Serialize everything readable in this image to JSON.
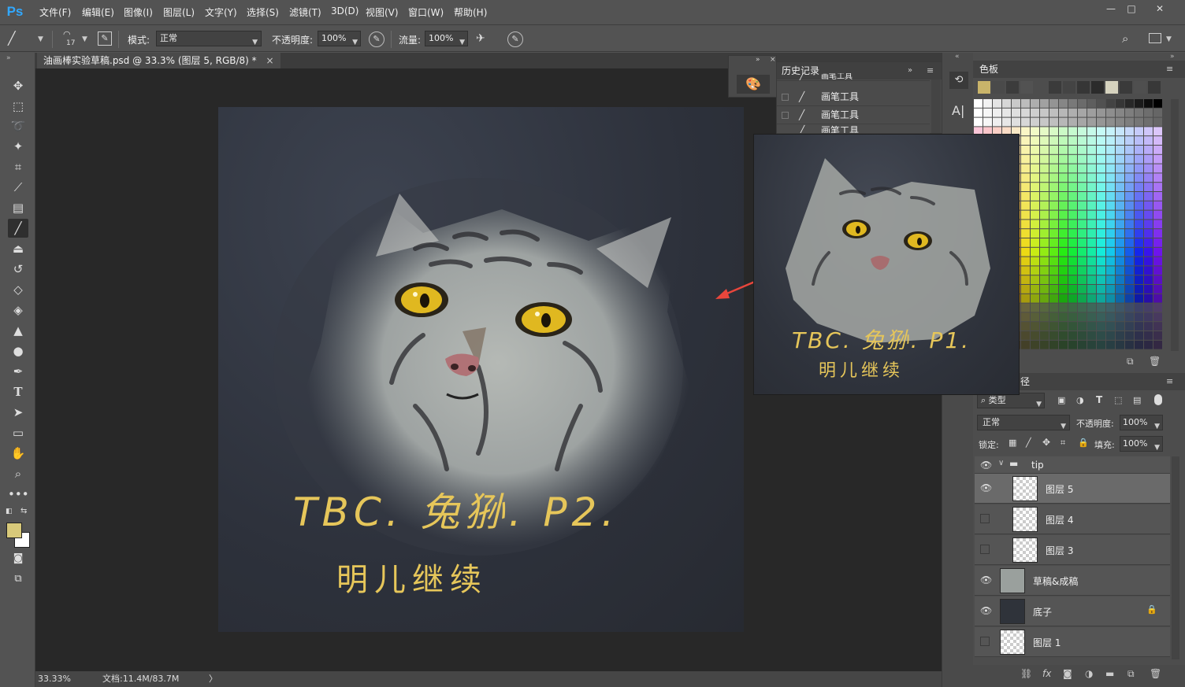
{
  "app": {
    "logo": "Ps"
  },
  "menu": [
    "文件(F)",
    "编辑(E)",
    "图像(I)",
    "图层(L)",
    "文字(Y)",
    "选择(S)",
    "滤镜(T)",
    "3D(D)",
    "视图(V)",
    "窗口(W)",
    "帮助(H)"
  ],
  "window_buttons": {
    "minimize": "—",
    "maximize": "□",
    "close": "✕"
  },
  "options": {
    "brush_size": "17",
    "mode_label": "模式:",
    "mode_value": "正常",
    "opacity_label": "不透明度:",
    "opacity_value": "100%",
    "flow_label": "流量:",
    "flow_value": "100%"
  },
  "document": {
    "tab_title": "油画棒实验草稿.psd @ 33.3% (图层 5, RGB/8) *",
    "tab_close": "×",
    "zoom": "33.33%",
    "doc_size": "文档:11.4M/83.7M",
    "status_arrow": "〉"
  },
  "canvas_art": {
    "line1": "TBC. 兔狲. P2.",
    "line2": "明儿继续"
  },
  "popup_art": {
    "line1": "TBC. 兔狲. P1.",
    "line2": "明儿继续"
  },
  "history": {
    "title": "历史记录",
    "items": [
      "画笔工具",
      "画笔工具",
      "画笔工具",
      "画笔工具"
    ]
  },
  "swatches": {
    "title": "色板",
    "recent": [
      "#c9b46a",
      "#4a4a4a",
      "#3c3c3c",
      "#525252",
      "#4d4d4d",
      "#3b3b3b",
      "#444",
      "#363636",
      "#2b2b2b",
      "#d6d3bf",
      "#3a3a3a",
      "#4f4f4f",
      "#383838"
    ]
  },
  "layers": {
    "tab_hint": "径",
    "filter_label": "类型",
    "blend_mode": "正常",
    "opacity_label": "不透明度:",
    "opacity_value": "100%",
    "lock_label": "锁定:",
    "fill_label": "填充:",
    "fill_value": "100%",
    "group_name": "tip",
    "items": [
      {
        "name": "图层 5",
        "visible": true,
        "selected": true
      },
      {
        "name": "图层 4",
        "visible": false,
        "selected": false
      },
      {
        "name": "图层 3",
        "visible": false,
        "selected": false
      },
      {
        "name": "草稿&成稿",
        "visible": true,
        "selected": false
      },
      {
        "name": "底子",
        "visible": true,
        "selected": false,
        "locked": true
      },
      {
        "name": "图层 1",
        "visible": false,
        "selected": false
      }
    ],
    "footer_icons": [
      "link-icon",
      "fx-icon",
      "mask-icon",
      "adjustment-icon",
      "folder-icon",
      "new-layer-icon",
      "trash-icon"
    ],
    "fx_label": "fx"
  },
  "colors": {
    "foreground": "#d8c97a",
    "background": "#ffffff",
    "accent": "#31a8ff",
    "arrow": "#e8463c",
    "handwriting": "#e6c65a"
  }
}
